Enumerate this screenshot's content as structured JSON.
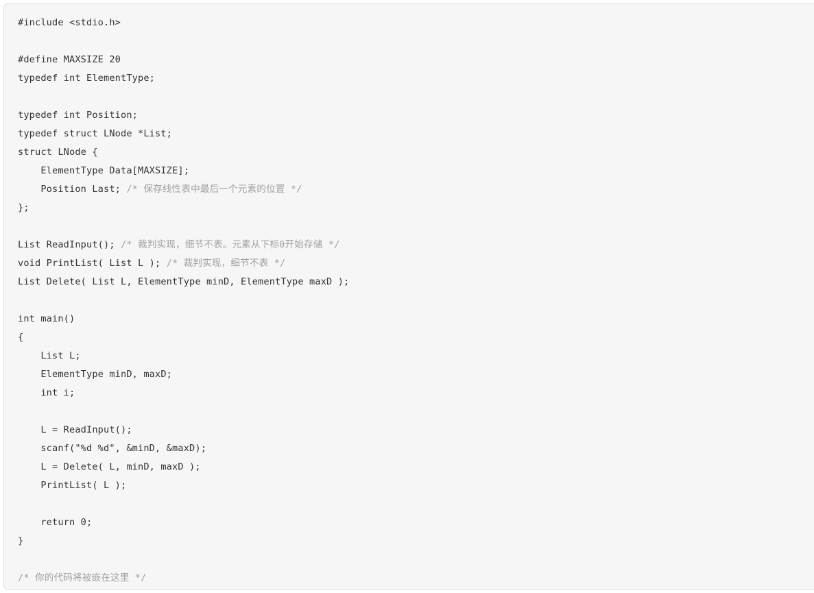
{
  "code_block": {
    "language": "c",
    "background_color": "#f6f6f6",
    "border_color": "#e0e0e0",
    "text_color": "#333333",
    "comment_color": "#a0a0a0",
    "lines": [
      {
        "text": "#include <stdio.h>",
        "kind": "code"
      },
      {
        "text": "",
        "kind": "blank"
      },
      {
        "text": "#define MAXSIZE 20",
        "kind": "code"
      },
      {
        "text": "typedef int ElementType;",
        "kind": "code"
      },
      {
        "text": "",
        "kind": "blank"
      },
      {
        "text": "typedef int Position;",
        "kind": "code"
      },
      {
        "text": "typedef struct LNode *List;",
        "kind": "code"
      },
      {
        "text": "struct LNode {",
        "kind": "code"
      },
      {
        "text": "    ElementType Data[MAXSIZE];",
        "kind": "code"
      },
      {
        "text": "    Position Last; ",
        "comment": "/* 保存线性表中最后一个元素的位置 */",
        "kind": "mixed"
      },
      {
        "text": "};",
        "kind": "code"
      },
      {
        "text": "",
        "kind": "blank"
      },
      {
        "text": "List ReadInput(); ",
        "comment": "/* 裁判实现，细节不表。元素从下标0开始存储 */",
        "kind": "mixed"
      },
      {
        "text": "void PrintList( List L ); ",
        "comment": "/* 裁判实现，细节不表 */",
        "kind": "mixed"
      },
      {
        "text": "List Delete( List L, ElementType minD, ElementType maxD );",
        "kind": "code"
      },
      {
        "text": "",
        "kind": "blank"
      },
      {
        "text": "int main()",
        "kind": "code"
      },
      {
        "text": "{",
        "kind": "code"
      },
      {
        "text": "    List L;",
        "kind": "code"
      },
      {
        "text": "    ElementType minD, maxD;",
        "kind": "code"
      },
      {
        "text": "    int i;",
        "kind": "code"
      },
      {
        "text": "",
        "kind": "blank"
      },
      {
        "text": "    L = ReadInput();",
        "kind": "code"
      },
      {
        "text": "    scanf(\"%d %d\", &minD, &maxD);",
        "kind": "code"
      },
      {
        "text": "    L = Delete( L, minD, maxD );",
        "kind": "code"
      },
      {
        "text": "    PrintList( L );",
        "kind": "code"
      },
      {
        "text": "",
        "kind": "blank"
      },
      {
        "text": "    return 0;",
        "kind": "code"
      },
      {
        "text": "}",
        "kind": "code"
      },
      {
        "text": "",
        "kind": "blank"
      },
      {
        "text": "",
        "comment": "/* 你的代码将被嵌在这里 */",
        "kind": "mixed"
      }
    ]
  }
}
